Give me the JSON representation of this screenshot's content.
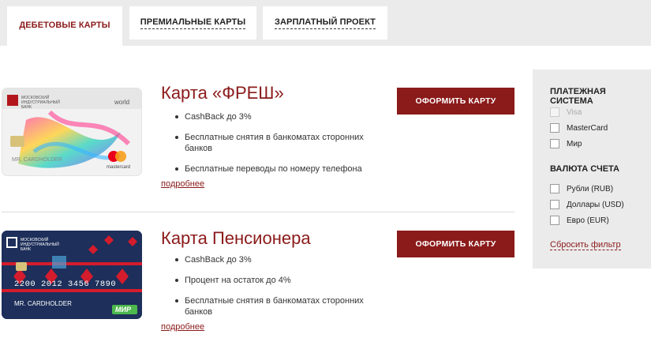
{
  "tabs": [
    {
      "label": "ДЕБЕТОВЫЕ КАРТЫ"
    },
    {
      "label": "ПРЕМИАЛЬНЫЕ КАРТЫ"
    },
    {
      "label": "ЗАРПЛАТНЫЙ ПРОЕКТ"
    }
  ],
  "cards": [
    {
      "title": "Карта «ФРЕШ»",
      "features": [
        "CashBack до 3%",
        "Бесплатные снятия в банкоматах сторонних банков",
        "Бесплатные переводы по номеру телефона"
      ],
      "more": "подробнее",
      "apply": "ОФОРМИТЬ КАРТУ",
      "image": {
        "bank": "МОСКОВСКИЙ ИНДУСТРИАЛЬНЫЙ БАНК",
        "tier": "world",
        "holder": "MR. CARDHOLDER",
        "network": "mastercard"
      }
    },
    {
      "title": "Карта Пенсионера",
      "features": [
        "CashBack до 3%",
        "Процент на остаток до 4%",
        "Бесплатные снятия в банкоматах сторонних банков"
      ],
      "more": "подробнее",
      "apply": "ОФОРМИТЬ КАРТУ",
      "image": {
        "bank": "МОСКОВСКИЙ ИНДУСТРИАЛЬНЫЙ БАНК",
        "number": "2200 2012 3456 7890",
        "holder": "MR. CARDHOLDER",
        "network": "МИР"
      }
    }
  ],
  "filter": {
    "payment_title": "ПЛАТЕЖНАЯ СИСТЕМА",
    "payment_options": [
      {
        "label": "Visa",
        "disabled": true
      },
      {
        "label": "MasterCard",
        "disabled": false
      },
      {
        "label": "Мир",
        "disabled": false
      }
    ],
    "currency_title": "ВАЛЮТА СЧЕТА",
    "currency_options": [
      {
        "label": "Рубли (RUB)"
      },
      {
        "label": "Доллары (USD)"
      },
      {
        "label": "Евро (EUR)"
      }
    ],
    "reset": "Сбросить фильтр"
  },
  "colors": {
    "brand": "#8b1a1a",
    "panel": "#ebebeb"
  }
}
